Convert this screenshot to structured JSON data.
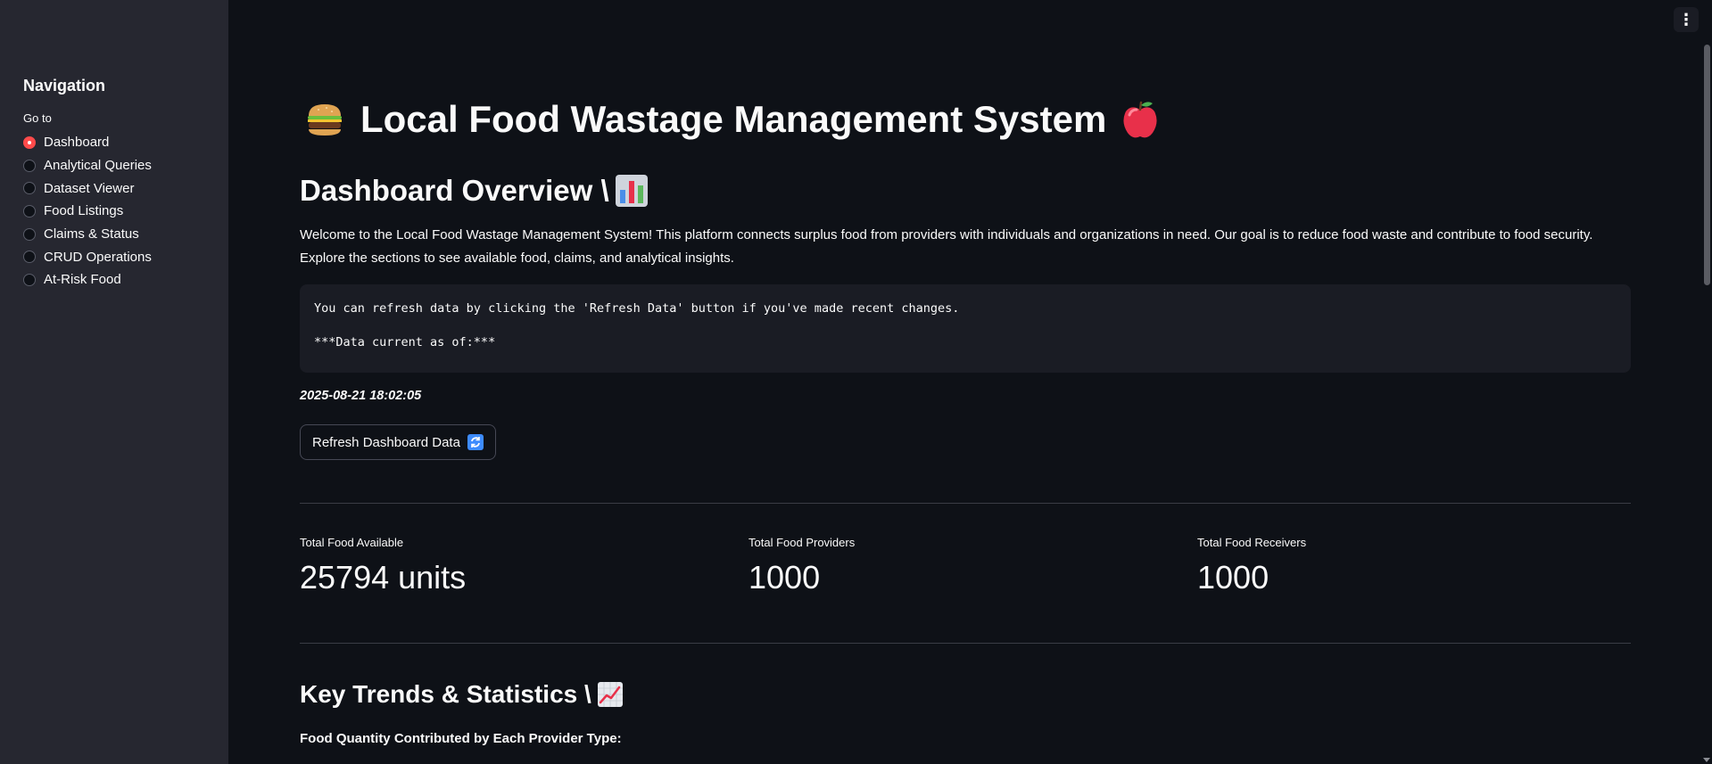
{
  "sidebar": {
    "title": "Navigation",
    "goto_label": "Go to",
    "items": [
      {
        "label": "Dashboard",
        "selected": true
      },
      {
        "label": "Analytical Queries",
        "selected": false
      },
      {
        "label": "Dataset Viewer",
        "selected": false
      },
      {
        "label": "Food Listings",
        "selected": false
      },
      {
        "label": "Claims & Status",
        "selected": false
      },
      {
        "label": "CRUD Operations",
        "selected": false
      },
      {
        "label": "At-Risk Food",
        "selected": false
      }
    ]
  },
  "header": {
    "title": "Local Food Wastage Management System",
    "leading_icon": "burger-icon",
    "trailing_icon": "apple-icon"
  },
  "overview": {
    "title": "Dashboard Overview \\",
    "title_icon": "bar-chart-icon",
    "intro": "Welcome to the Local Food Wastage Management System! This platform connects surplus food from providers with individuals and organizations in need. Our goal is to reduce food waste and contribute to food security. Explore the sections to see available food, claims, and analytical insights.",
    "code_line1": "You can refresh data by clicking the 'Refresh Data' button if you've made recent changes.",
    "code_line2": "***Data current as of:***",
    "timestamp": "2025-08-21 18:02:05",
    "refresh_button": "Refresh Dashboard Data",
    "refresh_icon": "refresh-icon"
  },
  "metrics": [
    {
      "label": "Total Food Available",
      "value": "25794 units"
    },
    {
      "label": "Total Food Providers",
      "value": "1000"
    },
    {
      "label": "Total Food Receivers",
      "value": "1000"
    }
  ],
  "trends": {
    "title": "Key Trends & Statistics \\",
    "title_icon": "trend-chart-icon",
    "subheading": "Food Quantity Contributed by Each Provider Type:"
  },
  "colors": {
    "background": "#0e1117",
    "sidebar": "#262730",
    "accent": "#ff4b4b",
    "code_bg": "#1a1c24"
  }
}
